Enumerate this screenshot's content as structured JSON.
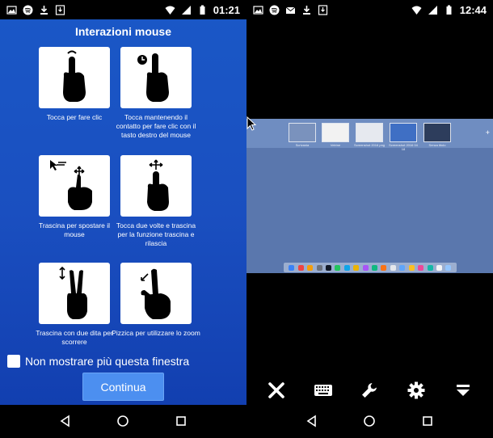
{
  "left_phone": {
    "status": {
      "time": "01:21"
    },
    "dialog": {
      "title": "Interazioni mouse",
      "gestures": [
        {
          "caption": "Tocca per fare clic",
          "icon": "tap-icon"
        },
        {
          "caption": "Tocca mantenendo il contatto per fare clic con il tasto destro del mouse",
          "icon": "long-press-icon"
        },
        {
          "caption": "Trascina per spostare il mouse",
          "icon": "drag-move-icon"
        },
        {
          "caption": "Tocca due volte e trascina per la funzione trascina e rilascia",
          "icon": "double-tap-drag-icon"
        },
        {
          "caption": "Trascina con due dita per scorrere",
          "icon": "two-finger-scroll-icon"
        },
        {
          "caption": "Pizzica per utilizzare lo zoom",
          "icon": "pinch-zoom-icon"
        }
      ],
      "checkbox_label": "Non mostrare più questa finestra",
      "checkbox_checked": false,
      "continue_label": "Continua"
    }
  },
  "right_phone": {
    "status": {
      "time": "12:44"
    },
    "desktop": {
      "spaces": [
        "Scrivania",
        "Vetrine",
        "Screenshot 2016 png",
        "Screenshot 2016 04 18",
        "Senza titolo"
      ]
    },
    "toolbar": [
      {
        "name": "close",
        "icon": "close-icon"
      },
      {
        "name": "keyboard",
        "icon": "keyboard-icon"
      },
      {
        "name": "settings-tools",
        "icon": "wrench-icon"
      },
      {
        "name": "preferences",
        "icon": "gear-icon"
      },
      {
        "name": "more",
        "icon": "chevron-down-icon"
      }
    ]
  },
  "colors": {
    "dialog_blue": "#1a57c6",
    "button_blue": "#4c8ff0",
    "desktop_blue": "#5a77ad"
  }
}
